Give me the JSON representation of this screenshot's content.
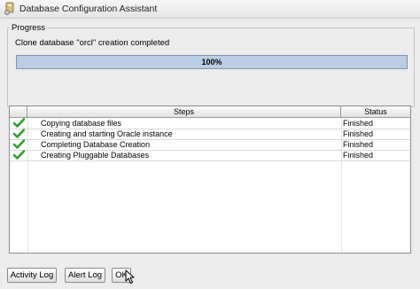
{
  "window": {
    "title": "Database Configuration Assistant"
  },
  "progress": {
    "group_label": "Progress",
    "message": "Clone database \"orcl\" creation completed",
    "percent_text": "100%",
    "fraction": 1.0
  },
  "table": {
    "headers": {
      "steps": "Steps",
      "status": "Status"
    },
    "rows": [
      {
        "step": "Copying database files",
        "status": "Finished",
        "done": true
      },
      {
        "step": "Creating and starting Oracle instance",
        "status": "Finished",
        "done": true
      },
      {
        "step": "Completing Database Creation",
        "status": "Finished",
        "done": true
      },
      {
        "step": "Creating Pluggable Databases",
        "status": "Finished",
        "done": true
      }
    ]
  },
  "buttons": {
    "activity_log": "Activity Log",
    "alert_log": "Alert Log",
    "ok": "OK"
  },
  "icons": {
    "app": "database-assistant-icon",
    "row_check": "green-checkmark-icon",
    "cursor": "mouse-pointer-icon"
  },
  "colors": {
    "progress_fill": "#b9cde4",
    "progress_border": "#7d96b5",
    "check_green": "#2e9e2e"
  }
}
